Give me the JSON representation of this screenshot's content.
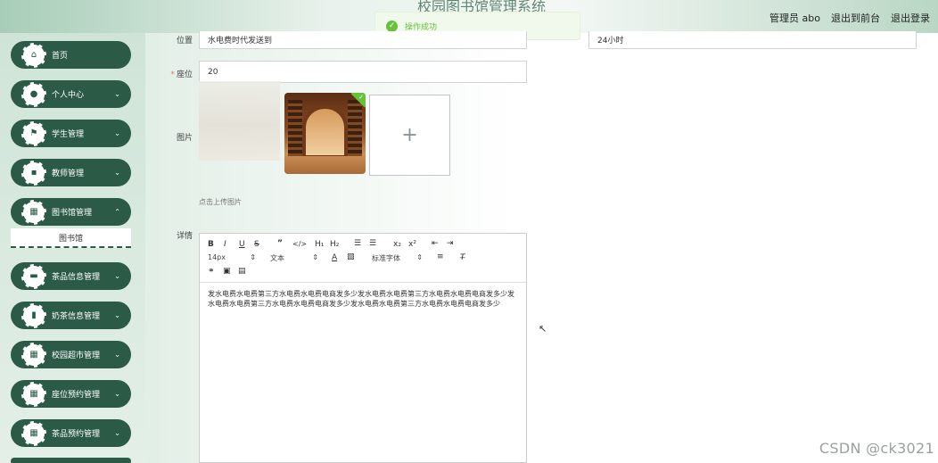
{
  "header": {
    "title": "校园图书馆管理系统",
    "nav": [
      "管理员 abo",
      "退出到前台",
      "退出登录"
    ]
  },
  "toast": {
    "message": "操作成功"
  },
  "sidebar": {
    "items": [
      {
        "label": "首页",
        "icon": "home-icon",
        "chevron": false
      },
      {
        "label": "个人中心",
        "icon": "user-icon",
        "chevron": true
      },
      {
        "label": "学生管理",
        "icon": "flag-icon",
        "chevron": true
      },
      {
        "label": "教师管理",
        "icon": "teacher-icon",
        "chevron": true
      },
      {
        "label": "图书馆管理",
        "icon": "grid-icon",
        "chevron": true
      },
      {
        "label": "茶品信息管理",
        "icon": "message-icon",
        "chevron": true
      },
      {
        "label": "奶茶信息管理",
        "icon": "book-icon",
        "chevron": true
      },
      {
        "label": "校园超市管理",
        "icon": "grid-icon",
        "chevron": true
      },
      {
        "label": "座位预约管理",
        "icon": "grid-icon",
        "chevron": true
      },
      {
        "label": "茶品预约管理",
        "icon": "grid-icon",
        "chevron": true
      }
    ],
    "submenu_label": "图书馆"
  },
  "form": {
    "location_label": "位置",
    "location_value": "水电费时代发送到",
    "hours_value": "24小时",
    "seats_label": "座位",
    "seats_value": "20",
    "image_label": "图片",
    "upload_tip": "点击上传图片",
    "detail_label": "详情"
  },
  "editor": {
    "font_size": "14px",
    "text_style": "文本",
    "font_family": "标准字体",
    "content": "发水电费水电费第三方水电费水电费电商发多少发水电费水电费第三方水电费水电费电商发多少发水电费水电费第三方水电费水电费电商发多少发水电费水电费第三方水电费水电费电商发多少"
  },
  "watermark": "CSDN @ck3021",
  "colors": {
    "sidebar_item": "#2b5b47",
    "success": "#67c23a"
  }
}
